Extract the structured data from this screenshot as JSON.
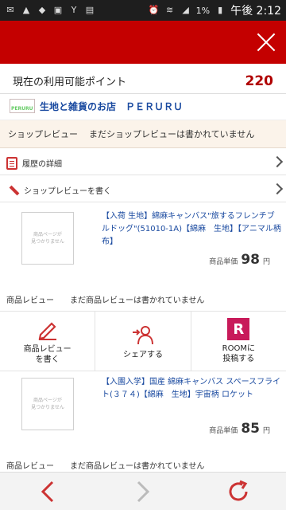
{
  "status_bar": {
    "time": "午後 2:12",
    "battery": "1%",
    "left_icons": [
      "mail-icon",
      "warning-icon",
      "app-icon",
      "image-icon",
      "yahoo-icon",
      "bag-icon"
    ],
    "right_icons": [
      "alarm-icon",
      "wifi-icon",
      "signal-icon",
      "battery-icon"
    ]
  },
  "header": {
    "accent": "#c40000"
  },
  "points": {
    "label": "現在の利用可能ポイント",
    "value": "220"
  },
  "shop": {
    "logo_text": "PERURU",
    "name": "生地と雑貨のお店　ＰＥＲＵＲＵ"
  },
  "shop_review": {
    "label": "ショップレビュー",
    "status": "まだショップレビューは書かれていません"
  },
  "links": {
    "history": "履歴の詳細",
    "write_shop_review": "ショップレビューを書く"
  },
  "products": [
    {
      "noimage": "商品ページが\n見つかりません",
      "title": "【入荷 生地】綿麻キャンバス\"旅するフレンチブルドッグ\"(51010-1A)【綿麻　生地】【アニマル柄　布】",
      "price_label": "商品単価",
      "price": "98",
      "unit": "円",
      "review_label": "商品レビュー",
      "review_status": "まだ商品レビューは書かれていません"
    },
    {
      "noimage": "商品ページが\n見つかりません",
      "title": "【入園入学】国産 綿麻キャンバス スペースフライト(３７４)【綿麻　生地】宇宙柄 ロケット",
      "price_label": "商品単価",
      "price": "85",
      "unit": "円",
      "review_label": "商品レビュー",
      "review_status": "まだ商品レビューは書かれていません"
    }
  ],
  "actions": {
    "write_review": "商品レビュー\nを書く",
    "share": "シェアする",
    "room": "ROOMに\n投稿する",
    "room_letter": "R"
  }
}
